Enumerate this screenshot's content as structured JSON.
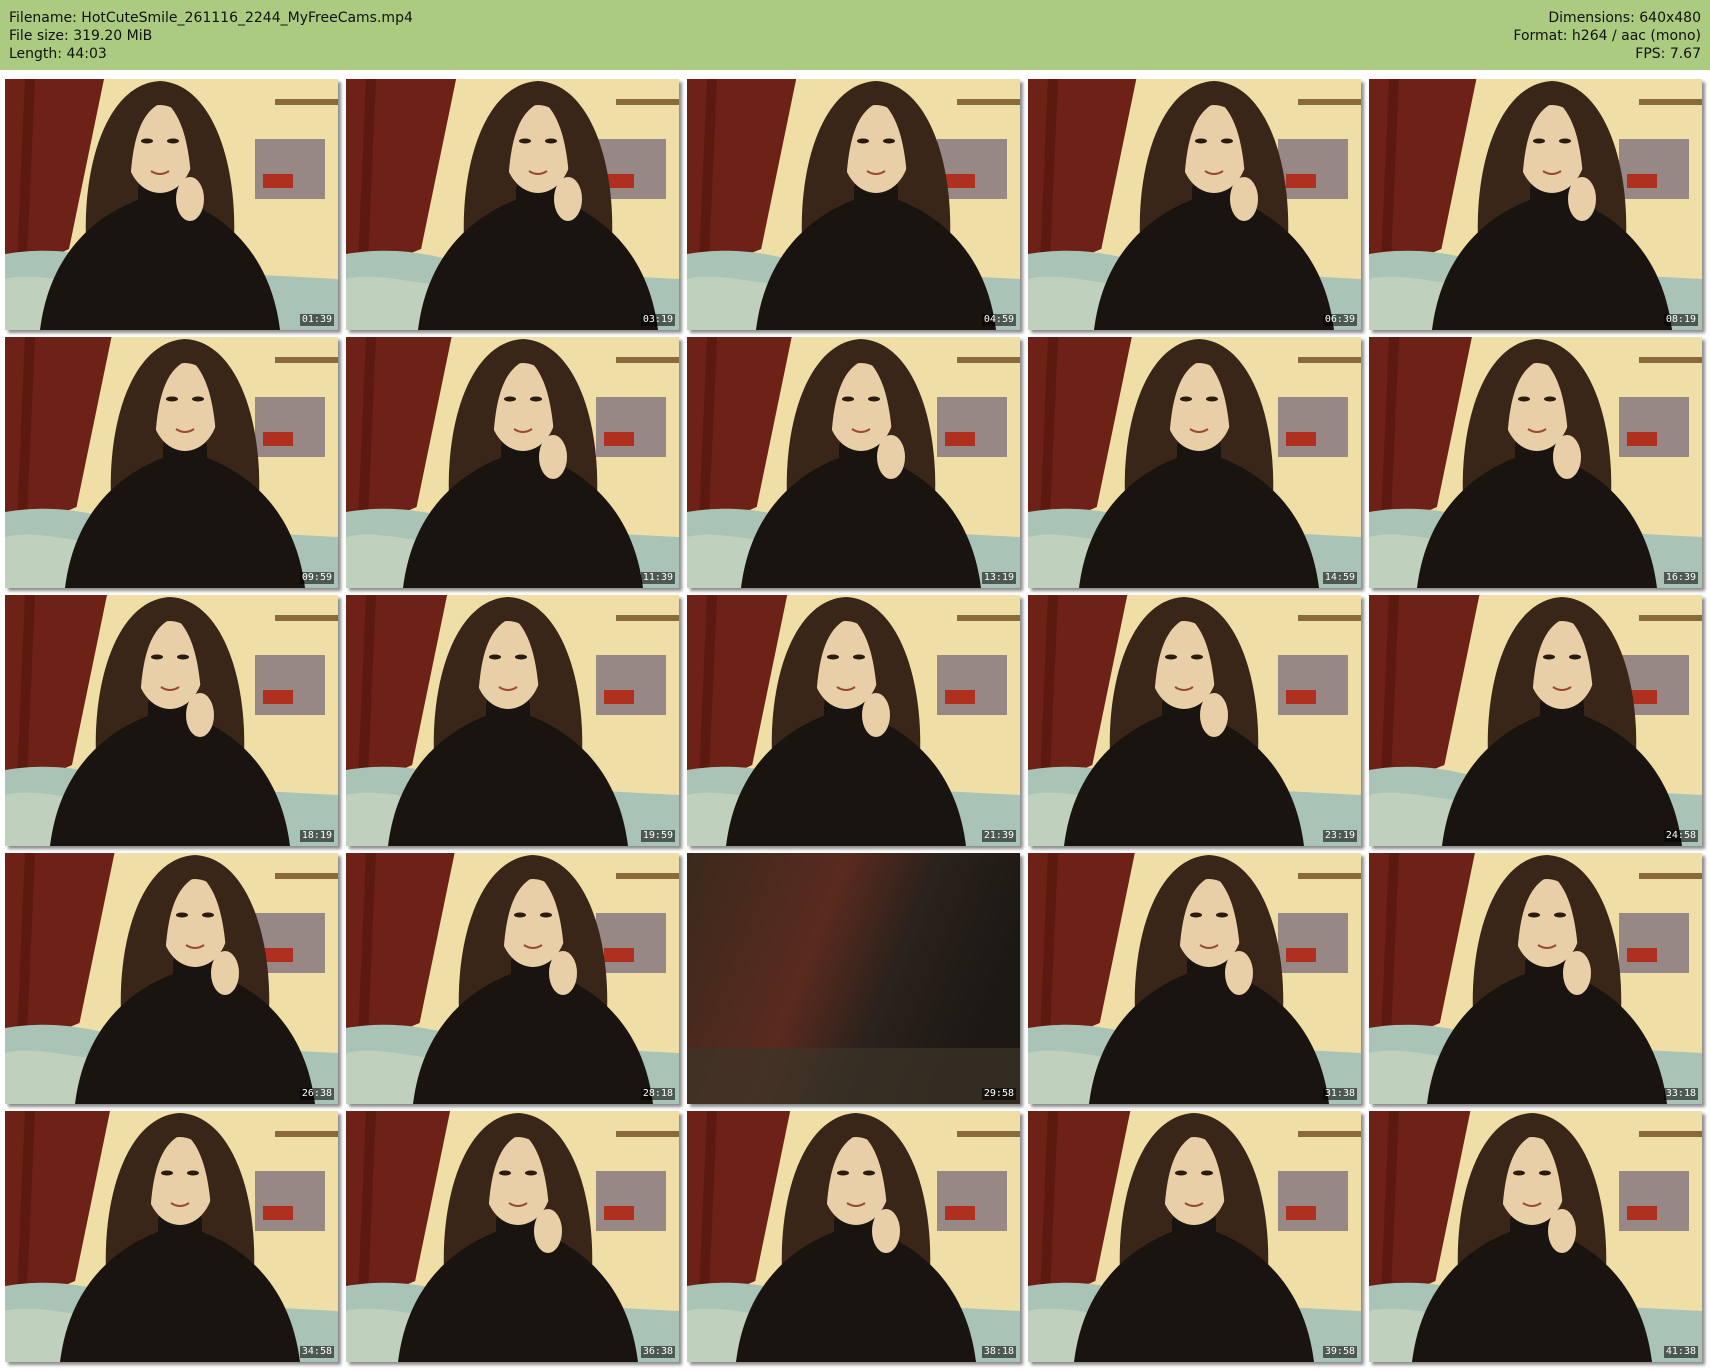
{
  "info": {
    "filename": "Filename: HotCuteSmile_261116_2244_MyFreeCams.mp4",
    "file_size": "File size: 319.20 MiB",
    "length": "Length: 44:03",
    "dimensions": "Dimensions: 640x480",
    "format": "Format: h264 / aac (mono)",
    "fps": "FPS: 7.67"
  },
  "colors": {
    "header_bg": "#abcb80",
    "wall": "#efdfa6",
    "curtain": "#6e2116",
    "sweater": "#1a1410",
    "hair": "#3a2618",
    "skin": "#e9cfa8",
    "bed": "#a9c4b6"
  },
  "thumbnails": [
    {
      "timestamp": "01:39",
      "blurred": false
    },
    {
      "timestamp": "03:19",
      "blurred": false
    },
    {
      "timestamp": "04:59",
      "blurred": false
    },
    {
      "timestamp": "06:39",
      "blurred": false
    },
    {
      "timestamp": "08:19",
      "blurred": false
    },
    {
      "timestamp": "09:59",
      "blurred": false
    },
    {
      "timestamp": "11:39",
      "blurred": false
    },
    {
      "timestamp": "13:19",
      "blurred": false
    },
    {
      "timestamp": "14:59",
      "blurred": false
    },
    {
      "timestamp": "16:39",
      "blurred": false
    },
    {
      "timestamp": "18:19",
      "blurred": false
    },
    {
      "timestamp": "19:59",
      "blurred": false
    },
    {
      "timestamp": "21:39",
      "blurred": false
    },
    {
      "timestamp": "23:19",
      "blurred": false
    },
    {
      "timestamp": "24:58",
      "blurred": false
    },
    {
      "timestamp": "26:38",
      "blurred": false
    },
    {
      "timestamp": "28:18",
      "blurred": false
    },
    {
      "timestamp": "29:58",
      "blurred": true
    },
    {
      "timestamp": "31:38",
      "blurred": false
    },
    {
      "timestamp": "33:18",
      "blurred": false
    },
    {
      "timestamp": "34:58",
      "blurred": false
    },
    {
      "timestamp": "36:38",
      "blurred": false
    },
    {
      "timestamp": "38:18",
      "blurred": false
    },
    {
      "timestamp": "39:58",
      "blurred": false
    },
    {
      "timestamp": "41:38",
      "blurred": false
    }
  ]
}
